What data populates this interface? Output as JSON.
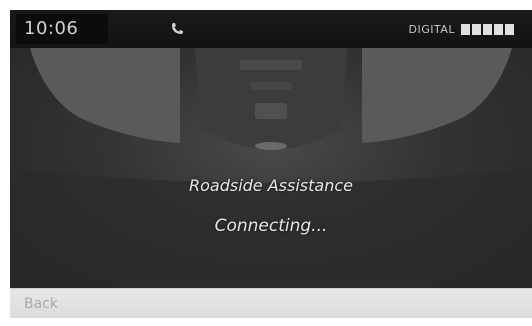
{
  "status_bar": {
    "time": "10:06",
    "phone_icon": "phone-handset-icon",
    "network_label": "DIGITAL",
    "signal_strength_bars": 5
  },
  "message": {
    "title": "Roadside Assistance",
    "status": "Connecting..."
  },
  "footer": {
    "back_label": "Back"
  },
  "colors": {
    "screen_bg": "#2b2b2b",
    "text": "#e6e6e6",
    "footer_bg": "#e2e2e2"
  }
}
